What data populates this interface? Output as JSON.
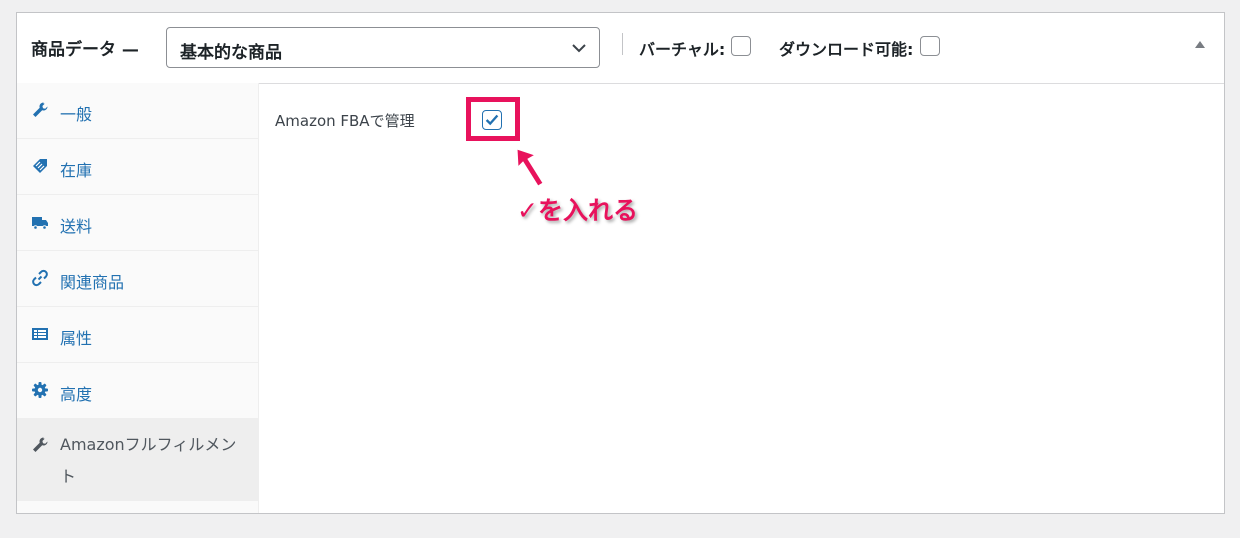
{
  "header": {
    "title": "商品データ —",
    "product_type": {
      "selected": "基本的な商品"
    },
    "virtual_label": "バーチャル:",
    "downloadable_label": "ダウンロード可能:"
  },
  "sidebar": {
    "items": [
      {
        "label": "一般",
        "icon": "wrench-icon"
      },
      {
        "label": "在庫",
        "icon": "tag-icon"
      },
      {
        "label": "送料",
        "icon": "truck-icon"
      },
      {
        "label": "関連商品",
        "icon": "link-icon"
      },
      {
        "label": "属性",
        "icon": "list-icon"
      },
      {
        "label": "高度",
        "icon": "gear-icon"
      },
      {
        "label": "Amazonフルフィルメント",
        "icon": "wrench-icon",
        "active": true
      }
    ]
  },
  "main": {
    "fba_label": "Amazon FBAで管理",
    "fba_checked": true
  },
  "annotation": {
    "text": "✓を入れる",
    "color": "#e8125c"
  },
  "colors": {
    "link": "#2271b1",
    "accent": "#e8125c",
    "border": "#c3c4c7"
  }
}
